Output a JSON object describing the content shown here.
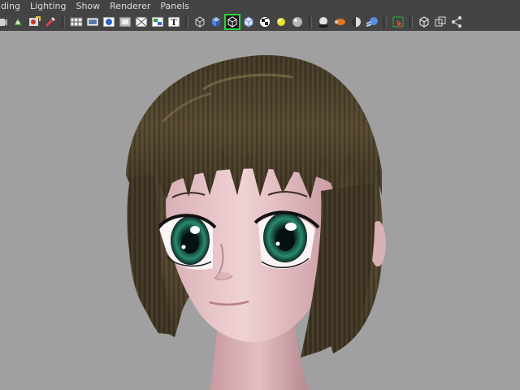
{
  "menu": {
    "items": [
      {
        "label": "ding"
      },
      {
        "label": "Lighting"
      },
      {
        "label": "Show"
      },
      {
        "label": "Renderer"
      },
      {
        "label": "Panels"
      }
    ]
  },
  "toolbar": {
    "icons": [
      "select-camera-icon",
      "camera-attributes-icon",
      "bookmark-icon",
      "image-plane-icon",
      "grid-icon",
      "film-gate-icon",
      "resolution-gate-icon",
      "gate-mask-icon",
      "field-chart-icon",
      "safe-action-icon",
      "safe-title-icon",
      "wireframe-icon",
      "smooth-shade-icon",
      "wireframe-on-shaded-icon",
      "default-material-icon",
      "textured-icon",
      "default-lighting-icon",
      "all-lights-icon",
      "shadows-icon",
      "hardware-texturing-icon",
      "ambient-occlusion-icon",
      "motion-blur-icon",
      "isolate-select-icon",
      "xray-icon",
      "xray-joints-icon",
      "xray-components-icon"
    ],
    "text_tool_glyph": "T"
  },
  "viewport": {
    "background": "#a0a0a0",
    "skin_color": "#e8c8c8",
    "hair_color": "#4a3f28",
    "eye_color": "#1a5f50"
  }
}
